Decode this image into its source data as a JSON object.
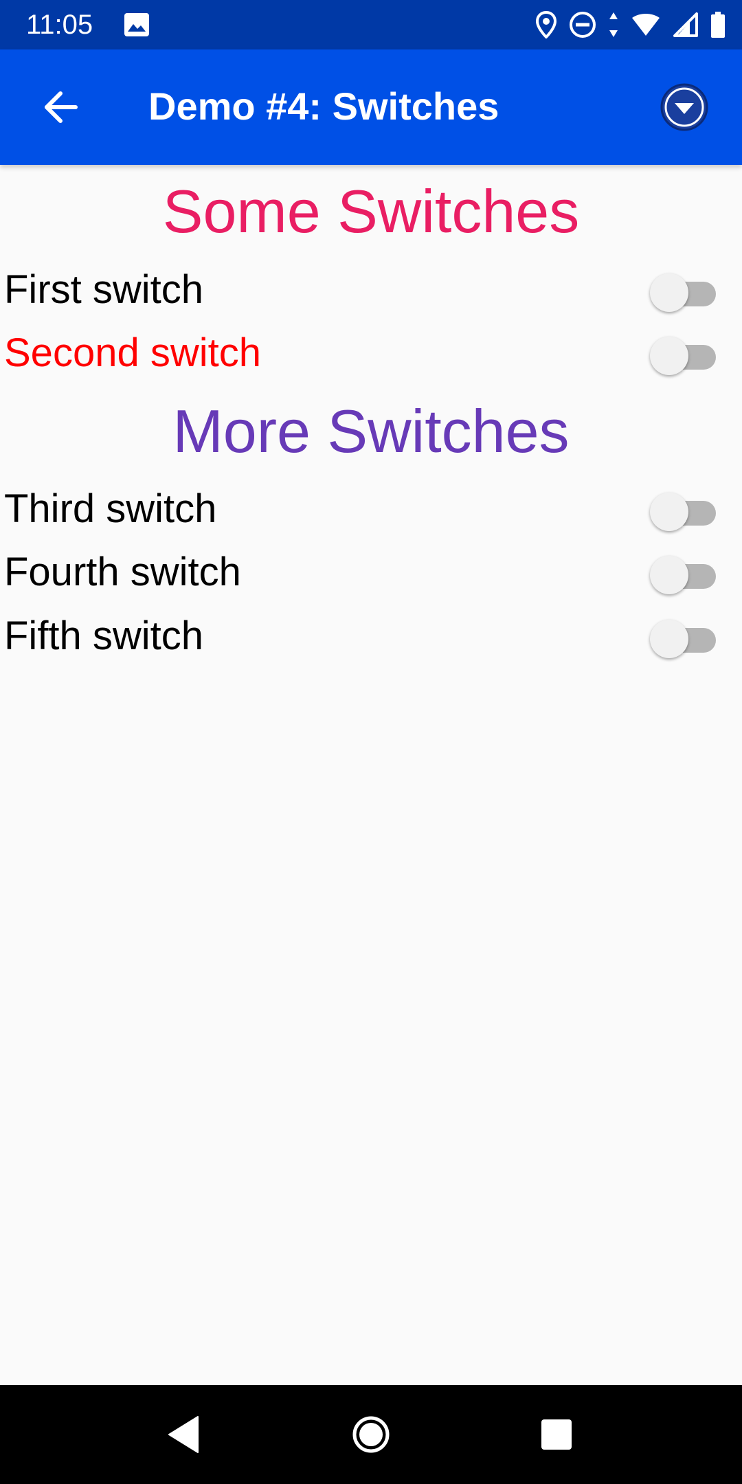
{
  "status_bar": {
    "time": "11:05",
    "icons": [
      "gallery-icon",
      "location-icon",
      "do-not-disturb-icon",
      "data-arrows-icon",
      "wifi-icon",
      "cellular-icon",
      "battery-icon"
    ]
  },
  "app_bar": {
    "title": "Demo #4: Switches",
    "back_icon": "arrow-back-icon",
    "menu_icon": "dropdown-circle-icon",
    "color": "#0050e6"
  },
  "sections": [
    {
      "heading": "Some Switches",
      "heading_color": "#e91e63",
      "switches": [
        {
          "label": "First switch",
          "checked": false,
          "label_color": "#000000"
        },
        {
          "label": "Second switch",
          "checked": false,
          "label_color": "#ff0000"
        }
      ]
    },
    {
      "heading": "More Switches",
      "heading_color": "#673ab7",
      "switches": [
        {
          "label": "Third switch",
          "checked": false,
          "label_color": "#000000"
        },
        {
          "label": "Fourth switch",
          "checked": false,
          "label_color": "#000000"
        },
        {
          "label": "Fifth switch",
          "checked": false,
          "label_color": "#000000"
        }
      ]
    }
  ],
  "nav_bar": {
    "icons": [
      "back-triangle-icon",
      "home-circle-icon",
      "recents-square-icon"
    ]
  }
}
